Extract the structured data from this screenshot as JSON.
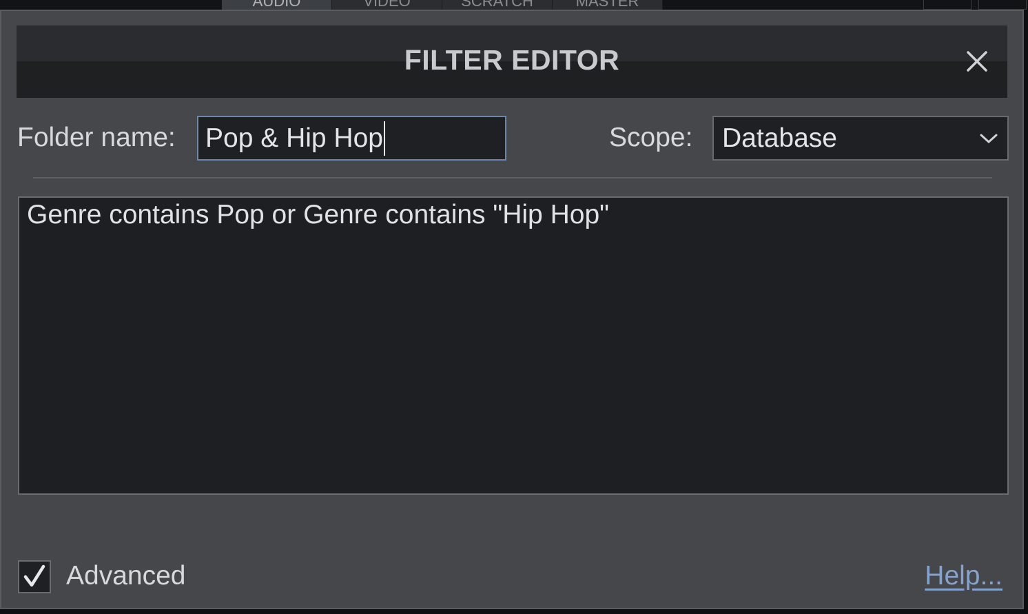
{
  "dialog": {
    "title": "FILTER EDITOR",
    "folder_name_label": "Folder name:",
    "folder_name_value": "Pop & Hip Hop",
    "scope_label": "Scope:",
    "scope_value": "Database",
    "filter_text": "Genre contains Pop or Genre contains \"Hip Hop\"",
    "advanced_label": "Advanced",
    "advanced_checked": true,
    "help_label": "Help..."
  },
  "background": {
    "tabs": [
      "AUDIO",
      "VIDEO",
      "SCRATCH",
      "MASTER"
    ]
  },
  "colors": {
    "accent": "#6d87a8",
    "link": "#86a3cf",
    "dialog_bg": "#45474b",
    "field_bg": "#1f2023"
  }
}
